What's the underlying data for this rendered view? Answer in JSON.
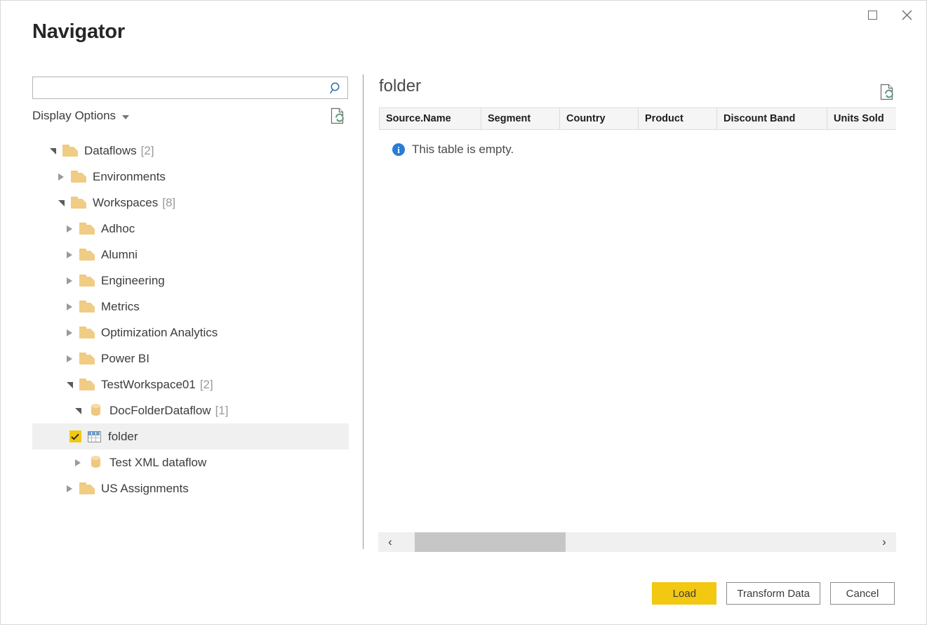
{
  "window": {
    "title": "Navigator",
    "maximize_icon": "maximize-icon",
    "close_icon": "close-icon"
  },
  "left_pane": {
    "search": {
      "value": "",
      "placeholder": "",
      "icon": "search-icon"
    },
    "display_options": {
      "label": "Display Options",
      "caret_icon": "chevron-down-icon"
    },
    "refresh_icon": "refresh-page-icon",
    "tree": [
      {
        "label": "Dataflows",
        "count": "[2]",
        "depth": 0,
        "icon": "folder-icon",
        "state": "expanded"
      },
      {
        "label": "Environments",
        "count": "",
        "depth": 1,
        "icon": "folder-icon",
        "state": "collapsed"
      },
      {
        "label": "Workspaces",
        "count": "[8]",
        "depth": 1,
        "icon": "folder-icon",
        "state": "expanded"
      },
      {
        "label": "Adhoc",
        "count": "",
        "depth": 2,
        "icon": "folder-icon",
        "state": "collapsed"
      },
      {
        "label": "Alumni",
        "count": "",
        "depth": 2,
        "icon": "folder-icon",
        "state": "collapsed"
      },
      {
        "label": "Engineering",
        "count": "",
        "depth": 2,
        "icon": "folder-icon",
        "state": "collapsed"
      },
      {
        "label": "Metrics",
        "count": "",
        "depth": 2,
        "icon": "folder-icon",
        "state": "collapsed"
      },
      {
        "label": "Optimization Analytics",
        "count": "",
        "depth": 2,
        "icon": "folder-icon",
        "state": "collapsed"
      },
      {
        "label": "Power BI",
        "count": "",
        "depth": 2,
        "icon": "folder-icon",
        "state": "collapsed"
      },
      {
        "label": "TestWorkspace01",
        "count": "[2]",
        "depth": 2,
        "icon": "folder-icon",
        "state": "expanded"
      },
      {
        "label": "DocFolderDataflow",
        "count": "[1]",
        "depth": 3,
        "icon": "dataflow-icon",
        "state": "expanded"
      },
      {
        "label": "folder",
        "count": "",
        "depth": 4,
        "icon": "table-icon",
        "state": "leaf",
        "checked": true,
        "selected": true
      },
      {
        "label": "Test XML dataflow",
        "count": "",
        "depth": 3,
        "icon": "dataflow-icon",
        "state": "collapsed"
      },
      {
        "label": "US Assignments",
        "count": "",
        "depth": 2,
        "icon": "folder-icon",
        "state": "collapsed"
      }
    ]
  },
  "right_pane": {
    "title": "folder",
    "refresh_icon": "refresh-page-icon",
    "columns": [
      "Source.Name",
      "Segment",
      "Country",
      "Product",
      "Discount Band",
      "Units Sold"
    ],
    "rows": [],
    "empty_message": "This table is empty.",
    "empty_icon": "info-icon",
    "scrollbar": {
      "left_arrow": "‹",
      "right_arrow": "›"
    }
  },
  "footer": {
    "load_label": "Load",
    "transform_label": "Transform Data",
    "cancel_label": "Cancel"
  },
  "colors": {
    "accent_yellow": "#f2c811",
    "folder_gold": "#f0cc84",
    "info_blue": "#2b7cd3",
    "search_blue": "#2f6fb0",
    "refresh_green": "#5f9e7e"
  }
}
